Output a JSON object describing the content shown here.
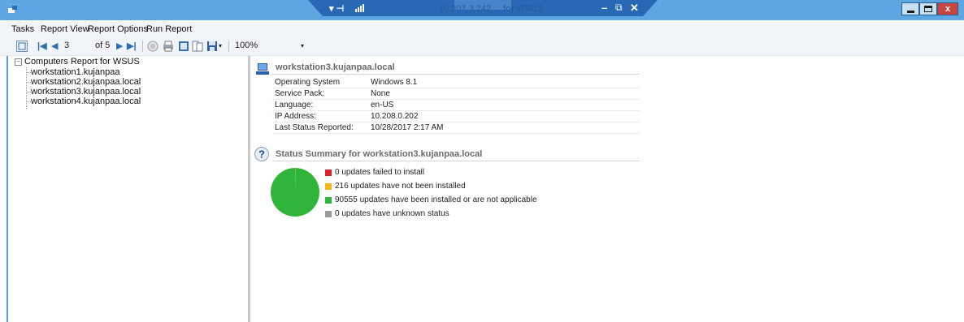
{
  "titlebar": {
    "rdp_text": "10.207.3.242 ... for WSUS",
    "close_glyph": "x"
  },
  "menu": {
    "items": [
      "Tasks",
      "Report View",
      "Report Options",
      "Run Report"
    ]
  },
  "toolbar": {
    "current_page": "3",
    "of_pages": "of 5",
    "zoom": "100%"
  },
  "tree": {
    "root": "Computers Report for WSUS",
    "items": [
      "workstation1.kujanpaa",
      "workstation2.kujanpaa.local",
      "workstation3.kujanpaa.local",
      "workstation4.kujanpaa.local"
    ]
  },
  "report": {
    "computer_title": "workstation3.kujanpaa.local",
    "rows": [
      {
        "label": "Operating System",
        "value": "Windows 8.1"
      },
      {
        "label": "Service Pack:",
        "value": "None"
      },
      {
        "label": "Language:",
        "value": "en-US"
      },
      {
        "label": "IP Address:",
        "value": "10.208.0.202"
      },
      {
        "label": "Last Status Reported:",
        "value": "10/28/2017 2:17 AM"
      }
    ],
    "status_title": "Status Summary for workstation3.kujanpaa.local",
    "legend": [
      {
        "text": "0 updates failed to install",
        "color": "#e0202c",
        "count": 0
      },
      {
        "text": "216 updates have not been installed",
        "color": "#f2b81b",
        "count": 216
      },
      {
        "text": "90555 updates have been installed or are not applicable",
        "color": "#2fb53a",
        "count": 90555
      },
      {
        "text": "0 updates have unknown status",
        "color": "#9a9a9a",
        "count": 0
      }
    ]
  },
  "colors": {
    "titlebar": "#5ea6e2",
    "pie_green": "#2fb53a",
    "accent_border": "#5a9bd8"
  },
  "icons": [
    "app-icon",
    "pin-icon",
    "signal-icon",
    "network-icon",
    "minimize-icon",
    "maximize-icon",
    "close-icon",
    "page-setup-icon",
    "first-page-icon",
    "prev-page-icon",
    "next-page-icon",
    "last-page-icon",
    "stop-icon",
    "print-icon",
    "print-layout-icon",
    "page-layout-icon",
    "export-icon",
    "computer-icon",
    "help-icon"
  ]
}
